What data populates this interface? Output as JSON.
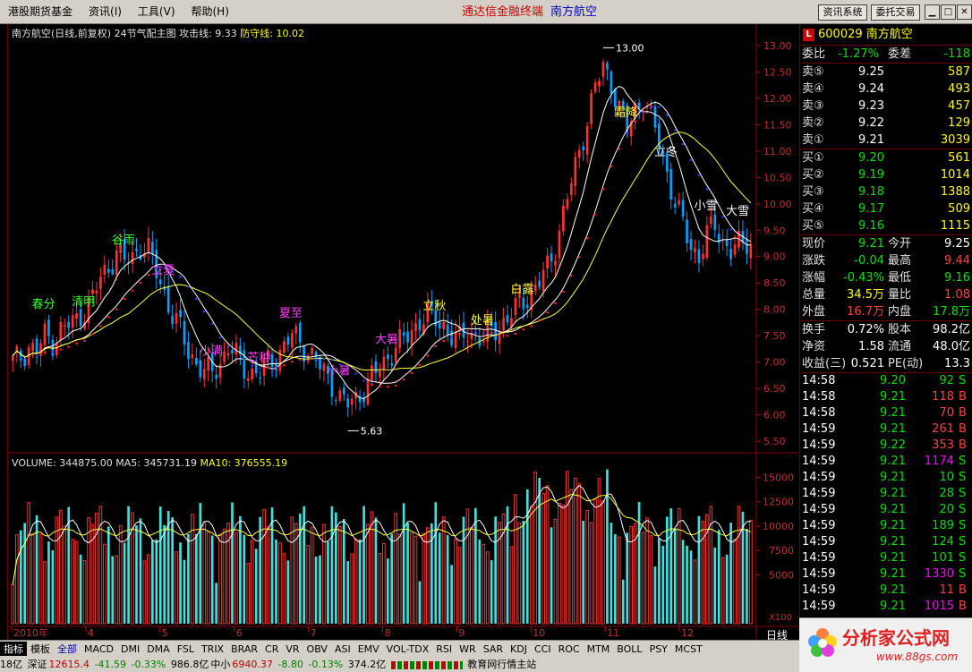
{
  "menu": {
    "items": [
      "港股期货基金",
      "资讯(I)",
      "工具(V)",
      "帮助(H)"
    ],
    "title": "通达信金融终端",
    "stock": "南方航空",
    "btn_news": "资讯系统",
    "btn_trade": "委托交易"
  },
  "chart_header": {
    "name": "南方航空(日线,前复权) 24节气配主图",
    "attack_label": "攻击线:",
    "attack_value": "9.33",
    "defense_label": "防守线:",
    "defense_value": "10.02"
  },
  "volume_header": {
    "vol": "VOLUME: 344875.00",
    "ma5": "MA5: 345731.19",
    "ma10": "MA10: 376555.19"
  },
  "colors": {
    "up": "#ff3030",
    "down": "#00a0ff",
    "ma5": "#ffffff",
    "ma10": "#ffff40"
  },
  "chart_data": [
    {
      "type": "candlestick",
      "y_axis": [
        13.0,
        12.5,
        12.0,
        11.5,
        11.0,
        10.5,
        10.0,
        9.5,
        9.0,
        8.5,
        8.0,
        7.5,
        7.0,
        6.5,
        6.0,
        5.5
      ],
      "ylim": [
        5.35,
        13.15
      ],
      "x_labels": [
        "2010年",
        "4",
        "5",
        "6",
        "7",
        "8",
        "9",
        "10",
        "11",
        "12"
      ],
      "high_mark": "13.00",
      "low_mark": "5.63",
      "close_path": [
        7.0,
        7.1,
        7.3,
        7.2,
        7.5,
        7.4,
        7.6,
        7.7,
        7.8,
        8.0,
        8.2,
        8.6,
        8.8,
        9.1,
        8.9,
        9.0,
        9.2,
        9.1,
        8.7,
        8.3,
        7.9,
        7.6,
        7.2,
        7.0,
        6.8,
        6.8,
        7.0,
        7.3,
        7.1,
        6.9,
        6.8,
        6.8,
        7.0,
        7.1,
        7.3,
        7.5,
        7.4,
        7.2,
        7.0,
        6.8,
        6.6,
        6.3,
        6.2,
        6.3,
        6.5,
        6.7,
        6.9,
        7.1,
        7.3,
        7.4,
        7.6,
        7.8,
        7.9,
        7.8,
        7.7,
        7.5,
        7.4,
        7.6,
        7.5,
        7.4,
        7.6,
        7.7,
        7.8,
        8.0,
        8.2,
        8.3,
        8.5,
        8.8,
        9.2,
        9.8,
        10.4,
        11.0,
        11.6,
        12.2,
        12.6,
        12.3,
        11.8,
        11.4,
        11.8,
        12.0,
        11.6,
        11.2,
        10.6,
        10.0,
        9.6,
        9.2,
        9.0,
        9.4,
        9.6,
        9.3,
        9.1,
        9.2,
        9.3
      ],
      "labels": [
        "春分",
        "清明",
        "谷雨",
        "立夏",
        "小满",
        "芒种",
        "夏至",
        "小暑",
        "大暑",
        "立秋",
        "处暑",
        "白露",
        "霜降",
        "立冬",
        "小雪",
        "大雪"
      ]
    },
    {
      "type": "bar",
      "name": "VOLUME",
      "y_axis": [
        15000,
        12500,
        10000,
        7500,
        5000
      ],
      "ylim": [
        0,
        16500
      ],
      "unit_label": "X100"
    }
  ],
  "panel": {
    "code": "600029",
    "name": "南方航空",
    "webi_label": "委比",
    "webi": "-1.27%",
    "wecha_label": "委差",
    "wecha": "-118",
    "asks": [
      {
        "label": "卖⑤",
        "price": "9.25",
        "vol": "587"
      },
      {
        "label": "卖④",
        "price": "9.24",
        "vol": "493"
      },
      {
        "label": "卖③",
        "price": "9.23",
        "vol": "457"
      },
      {
        "label": "卖②",
        "price": "9.22",
        "vol": "129"
      },
      {
        "label": "卖①",
        "price": "9.21",
        "vol": "3039"
      }
    ],
    "bids": [
      {
        "label": "买①",
        "price": "9.20",
        "vol": "561"
      },
      {
        "label": "买②",
        "price": "9.19",
        "vol": "1014"
      },
      {
        "label": "买③",
        "price": "9.18",
        "vol": "1388"
      },
      {
        "label": "买④",
        "price": "9.17",
        "vol": "509"
      },
      {
        "label": "买⑤",
        "price": "9.16",
        "vol": "1115"
      }
    ],
    "stats": [
      {
        "l1": "现价",
        "v1": "9.21",
        "c1": "g",
        "l2": "今开",
        "v2": "9.25",
        "c2": "w"
      },
      {
        "l1": "涨跌",
        "v1": "-0.04",
        "c1": "g",
        "l2": "最高",
        "v2": "9.44",
        "c2": "r"
      },
      {
        "l1": "涨幅",
        "v1": "-0.43%",
        "c1": "g",
        "l2": "最低",
        "v2": "9.16",
        "c2": "g"
      },
      {
        "l1": "总量",
        "v1": "34.5万",
        "c1": "yel",
        "l2": "量比",
        "v2": "1.08",
        "c2": "r"
      },
      {
        "l1": "外盘",
        "v1": "16.7万",
        "c1": "r",
        "l2": "内盘",
        "v2": "17.8万",
        "c2": "g"
      }
    ],
    "stats2": [
      {
        "l1": "换手",
        "v1": "0.72%",
        "l2": "股本",
        "v2": "98.2亿"
      },
      {
        "l1": "净资",
        "v1": "1.58",
        "l2": "流通",
        "v2": "48.0亿"
      },
      {
        "l1": "收益(三)",
        "v1": "0.521",
        "l2": "PE(动)",
        "v2": "13.3"
      }
    ],
    "ticks": [
      {
        "t": "14:58",
        "p": "9.20",
        "v": "92",
        "s": "S",
        "c": "g",
        "vc": "g"
      },
      {
        "t": "14:58",
        "p": "9.21",
        "v": "118",
        "s": "B",
        "c": "g",
        "vc": "r"
      },
      {
        "t": "14:58",
        "p": "9.21",
        "v": "70",
        "s": "B",
        "c": "g",
        "vc": "r"
      },
      {
        "t": "14:59",
        "p": "9.21",
        "v": "261",
        "s": "B",
        "c": "g",
        "vc": "r"
      },
      {
        "t": "14:59",
        "p": "9.22",
        "v": "353",
        "s": "B",
        "c": "g",
        "vc": "r"
      },
      {
        "t": "14:59",
        "p": "9.21",
        "v": "1174",
        "s": "S",
        "c": "g",
        "vc": "m"
      },
      {
        "t": "14:59",
        "p": "9.21",
        "v": "10",
        "s": "S",
        "c": "g",
        "vc": "g"
      },
      {
        "t": "14:59",
        "p": "9.21",
        "v": "28",
        "s": "S",
        "c": "g",
        "vc": "g"
      },
      {
        "t": "14:59",
        "p": "9.21",
        "v": "20",
        "s": "S",
        "c": "g",
        "vc": "g"
      },
      {
        "t": "14:59",
        "p": "9.21",
        "v": "189",
        "s": "S",
        "c": "g",
        "vc": "g"
      },
      {
        "t": "14:59",
        "p": "9.21",
        "v": "124",
        "s": "S",
        "c": "g",
        "vc": "g"
      },
      {
        "t": "14:59",
        "p": "9.21",
        "v": "101",
        "s": "S",
        "c": "g",
        "vc": "g"
      },
      {
        "t": "14:59",
        "p": "9.21",
        "v": "1330",
        "s": "S",
        "c": "g",
        "vc": "m"
      },
      {
        "t": "14:59",
        "p": "9.21",
        "v": "11",
        "s": "B",
        "c": "g",
        "vc": "r"
      },
      {
        "t": "14:59",
        "p": "9.21",
        "v": "1015",
        "s": "B",
        "c": "g",
        "vc": "m"
      }
    ]
  },
  "toolbar": [
    "指标",
    "模板",
    "全部",
    "MACD",
    "DMI",
    "DMA",
    "FSL",
    "TRIX",
    "BRAR",
    "CR",
    "VR",
    "OBV",
    "ASI",
    "EMV",
    "VOL-TDX",
    "RSI",
    "WR",
    "SAR",
    "KDJ",
    "CCI",
    "ROC",
    "MTM",
    "BOLL",
    "PSY",
    "MCST"
  ],
  "day_label": "日线",
  "status": {
    "a": "18亿",
    "sz_label": "深证",
    "sz": "12615.4",
    "sz_chg": "-41.59",
    "sz_pct": "-0.33%",
    "sz_amt": "986.8亿",
    "zx_label": "中小",
    "zx": "6940.37",
    "zx_chg": "-8.80",
    "zx_pct": "-0.13%",
    "zx_amt": "374.2亿",
    "msg": "教育网行情主站"
  },
  "logo": {
    "title": "分析家公式网",
    "url": "www.88gs.com"
  }
}
